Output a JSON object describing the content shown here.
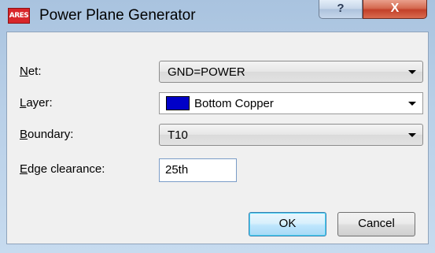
{
  "window": {
    "title": "Power Plane Generator",
    "app_icon_text": "ARES",
    "help_label": "?",
    "close_label": "X"
  },
  "form": {
    "net": {
      "label_ul": "N",
      "label_rest": "et:",
      "value": "GND=POWER"
    },
    "layer": {
      "label_ul": "L",
      "label_rest": "ayer:",
      "value": "Bottom Copper",
      "swatch_color": "#0000c8"
    },
    "boundary": {
      "label_ul": "B",
      "label_rest": "oundary:",
      "value": "T10"
    },
    "edge_clearance": {
      "label_ul": "E",
      "label_rest": "dge clearance:",
      "value": "25th"
    }
  },
  "buttons": {
    "ok_label": "OK",
    "cancel_label": "Cancel"
  }
}
